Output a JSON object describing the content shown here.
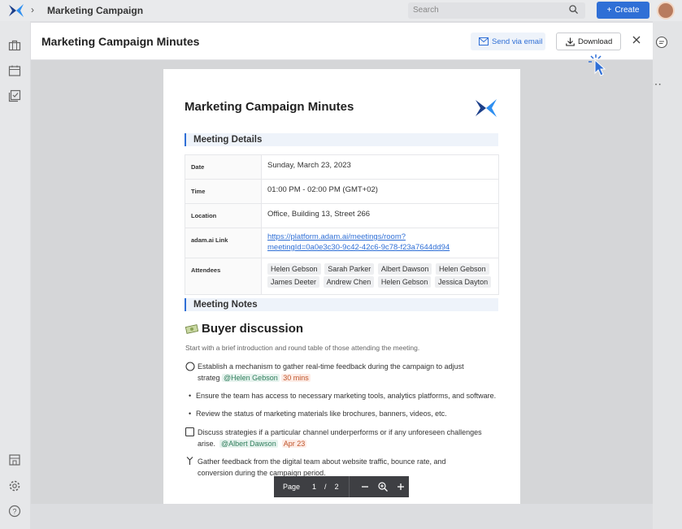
{
  "topbar": {
    "breadcrumb": "Marketing Campaign",
    "search_placeholder": "Search",
    "create_label": "Create"
  },
  "modal": {
    "title": "Marketing Campaign Minutes",
    "send_email_label": "Send via email",
    "download_label": "Download"
  },
  "document": {
    "title": "Marketing Campaign Minutes",
    "details_heading": "Meeting Details",
    "details": {
      "date_label": "Date",
      "date_value": "Sunday, March 23, 2023",
      "time_label": "Time",
      "time_value": "01:00 PM - 02:00 PM (GMT+02)",
      "location_label": "Location",
      "location_value": "Office, Building 13, Street 266",
      "link_label": "adam.ai Link",
      "link_line1": "https://platform.adam.ai/meetings/room?",
      "link_line2": "meetingId=0a0e3c30-9c42-42c6-9c78-f23a7644dd94",
      "attendees_label": "Attendees",
      "attendees": [
        "Helen Gebson",
        "Sarah Parker",
        "Albert Dawson",
        "Helen Gebson",
        "James Deeter",
        "Andrew Chen",
        "Helen Gebson",
        "Jessica Dayton"
      ]
    },
    "notes_heading": "Meeting Notes",
    "topic_title": "Buyer discussion",
    "topic_intro": "Start with a brief introduction and round table of those attending the meeting.",
    "items": {
      "i1_text_a": "Establish a mechanism to gather real-time feedback during the campaign to adjust",
      "i1_text_b": "strateg",
      "i1_mention": "@Helen Gebson",
      "i1_due": "30 mins",
      "i2_text": "Ensure the team has access to necessary marketing tools, analytics platforms, and software.",
      "i3_text": "Review the status of marketing materials like brochures, banners, videos, etc.",
      "i4_text_a": "Discuss strategies if a particular channel underperforms or if any unforeseen challenges",
      "i4_text_b": "arise.",
      "i4_mention": "@Albert Dawson",
      "i4_due": "Apr 23",
      "i5_text_a": "Gather feedback from the digital team about website traffic, bounce rate, and",
      "i5_text_b": "conversion during the campaign period."
    }
  },
  "pager": {
    "page_label": "Page",
    "current": "1",
    "separator": "/",
    "total": "2"
  },
  "colors": {
    "accent": "#2f6fd6",
    "mention": "#2e7d5b",
    "due": "#c0552b"
  },
  "icons": [
    "logo-icon",
    "chevron-right-icon",
    "search-icon",
    "plus-icon",
    "briefcase-icon",
    "calendar-icon",
    "checklist-icon",
    "building-icon",
    "settings-icon",
    "help-icon",
    "mail-icon",
    "download-icon",
    "close-icon",
    "pointer-cursor-icon",
    "chat-icon",
    "more-icon",
    "money-icon",
    "zoom-out-icon",
    "zoom-in-icon",
    "zoom-plus-icon"
  ]
}
